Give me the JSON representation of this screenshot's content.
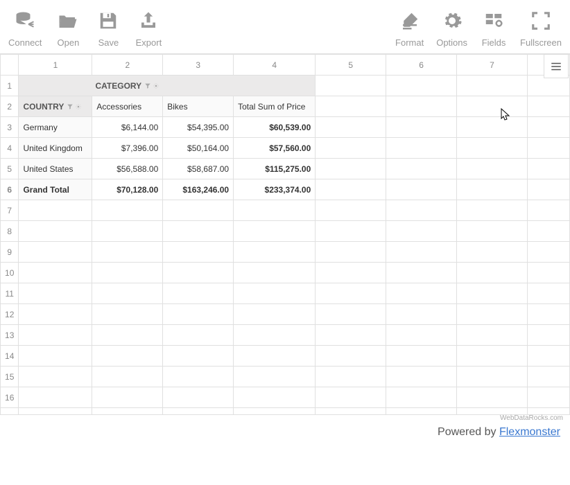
{
  "toolbar": {
    "left": [
      {
        "name": "connect",
        "label": "Connect",
        "icon": "database-share-icon"
      },
      {
        "name": "open",
        "label": "Open",
        "icon": "folder-open-icon"
      },
      {
        "name": "save",
        "label": "Save",
        "icon": "floppy-disk-icon"
      },
      {
        "name": "export",
        "label": "Export",
        "icon": "export-icon"
      }
    ],
    "right": [
      {
        "name": "format",
        "label": "Format",
        "icon": "edit-note-icon"
      },
      {
        "name": "options",
        "label": "Options",
        "icon": "gear-icon"
      },
      {
        "name": "fields",
        "label": "Fields",
        "icon": "fields-icon"
      },
      {
        "name": "fullscreen",
        "label": "Fullscreen",
        "icon": "fullscreen-icon"
      }
    ]
  },
  "grid": {
    "col_headers": [
      "1",
      "2",
      "3",
      "4",
      "5",
      "6",
      "7",
      ""
    ],
    "category_label": "CATEGORY",
    "country_label": "COUNTRY",
    "column_fields": [
      "Accessories",
      "Bikes",
      "Total Sum of Price"
    ],
    "rows": [
      {
        "label": "Germany",
        "values": [
          "$6,144.00",
          "$54,395.00",
          "$60,539.00"
        ],
        "bold_last": true
      },
      {
        "label": "United Kingdom",
        "values": [
          "$7,396.00",
          "$50,164.00",
          "$57,560.00"
        ],
        "bold_last": true
      },
      {
        "label": "United States",
        "values": [
          "$56,588.00",
          "$58,687.00",
          "$115,275.00"
        ],
        "bold_last": true
      },
      {
        "label": "Grand Total",
        "values": [
          "$70,128.00",
          "$163,246.00",
          "$233,374.00"
        ],
        "grand": true
      }
    ],
    "empty_rows_from": 7,
    "empty_rows_to": 17
  },
  "footer": {
    "credits": "WebDataRocks.com",
    "powered_prefix": "Powered by ",
    "powered_link": "Flexmonster"
  },
  "chart_data": {
    "type": "table",
    "row_dimension": "Country",
    "column_dimension": "Category",
    "measure": "Sum of Price",
    "columns": [
      "Accessories",
      "Bikes",
      "Total Sum of Price"
    ],
    "rows": [
      {
        "Country": "Germany",
        "Accessories": 6144.0,
        "Bikes": 54395.0,
        "Total": 60539.0
      },
      {
        "Country": "United Kingdom",
        "Accessories": 7396.0,
        "Bikes": 50164.0,
        "Total": 57560.0
      },
      {
        "Country": "United States",
        "Accessories": 56588.0,
        "Bikes": 58687.0,
        "Total": 115275.0
      }
    ],
    "grand_total": {
      "Accessories": 70128.0,
      "Bikes": 163246.0,
      "Total": 233374.0
    },
    "currency": "USD"
  }
}
